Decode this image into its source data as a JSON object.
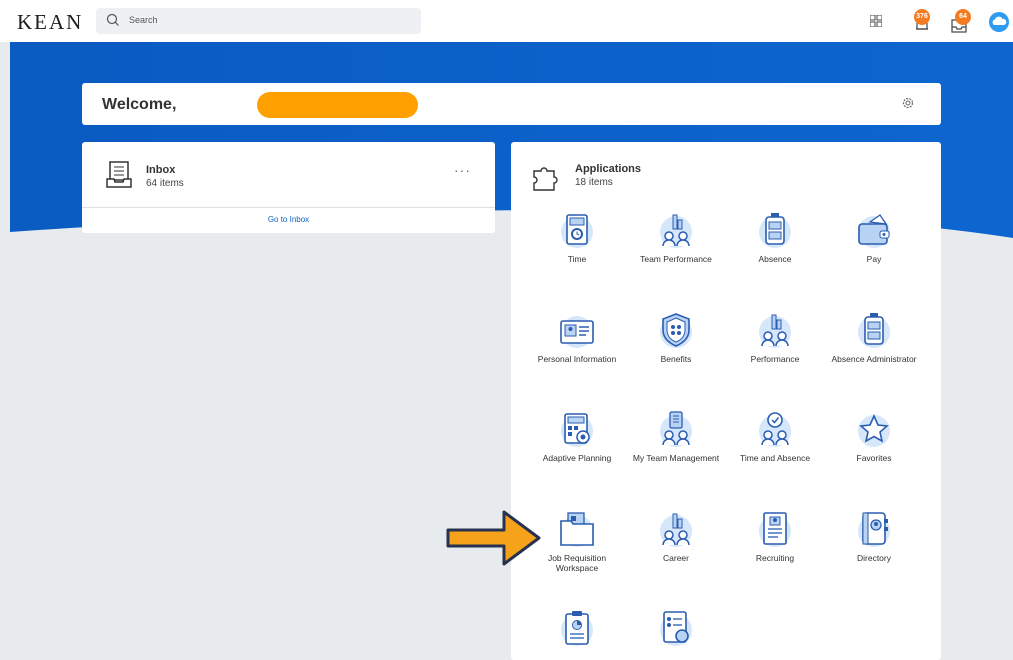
{
  "header": {
    "logo": "KEAN",
    "search_placeholder": "Search",
    "notifications_count": "376",
    "inbox_count": "64"
  },
  "welcome": {
    "text": "Welcome,"
  },
  "inbox": {
    "title": "Inbox",
    "count": "64 items",
    "more": "···",
    "link": "Go to Inbox"
  },
  "applications": {
    "title": "Applications",
    "count": "18 items",
    "items": [
      {
        "label": "Time",
        "icon": "time-icon"
      },
      {
        "label": "Team Performance",
        "icon": "team-performance-icon"
      },
      {
        "label": "Absence",
        "icon": "absence-icon"
      },
      {
        "label": "Pay",
        "icon": "pay-icon"
      },
      {
        "label": "Personal Information",
        "icon": "personal-information-icon"
      },
      {
        "label": "Benefits",
        "icon": "benefits-icon"
      },
      {
        "label": "Performance",
        "icon": "performance-icon"
      },
      {
        "label": "Absence Administrator",
        "icon": "absence-administrator-icon"
      },
      {
        "label": "Adaptive Planning",
        "icon": "adaptive-planning-icon"
      },
      {
        "label": "My Team Management",
        "icon": "my-team-management-icon"
      },
      {
        "label": "Time and Absence",
        "icon": "time-and-absence-icon"
      },
      {
        "label": "Favorites",
        "icon": "favorites-icon"
      },
      {
        "label": "Job Requisition Workspace",
        "icon": "job-requisition-icon"
      },
      {
        "label": "Career",
        "icon": "career-icon"
      },
      {
        "label": "Recruiting",
        "icon": "recruiting-icon"
      },
      {
        "label": "Directory",
        "icon": "directory-icon"
      },
      {
        "label": "",
        "icon": "report-clipboard-icon"
      },
      {
        "label": "",
        "icon": "checklist-search-icon"
      }
    ]
  },
  "colors": {
    "header_blue": "#0c62c9",
    "icon_blue": "#2a5db0",
    "icon_light": "#b9d3f5",
    "badge_orange": "#f47b20",
    "redaction_orange": "#ff9f00"
  }
}
